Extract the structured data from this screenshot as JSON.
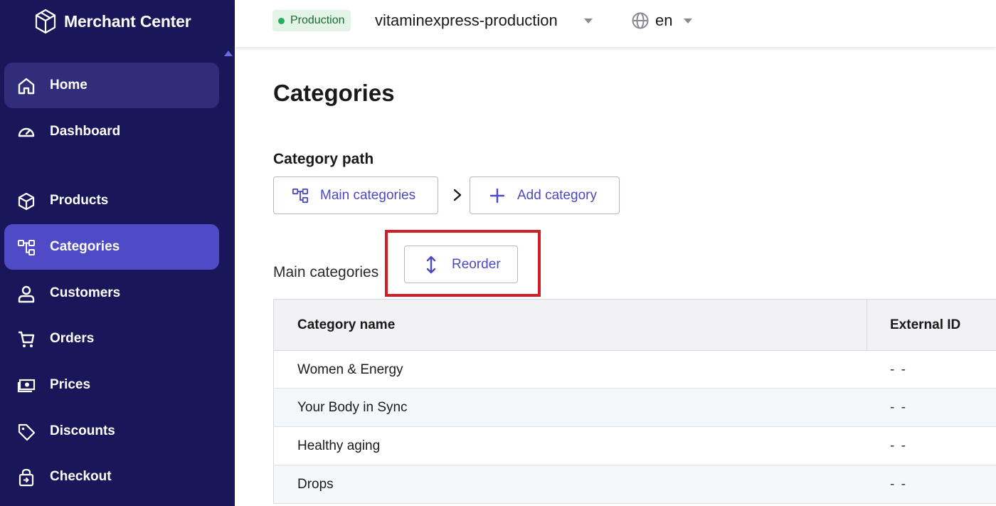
{
  "app": {
    "brand": "Merchant Center"
  },
  "sidebar": {
    "items": [
      {
        "label": "Home",
        "icon": "home-icon"
      },
      {
        "label": "Dashboard",
        "icon": "gauge-icon"
      },
      {
        "label": "Products",
        "icon": "cube-icon"
      },
      {
        "label": "Categories",
        "icon": "tree-icon"
      },
      {
        "label": "Customers",
        "icon": "user-icon"
      },
      {
        "label": "Orders",
        "icon": "cart-icon"
      },
      {
        "label": "Prices",
        "icon": "money-icon"
      },
      {
        "label": "Discounts",
        "icon": "tag-icon"
      },
      {
        "label": "Checkout",
        "icon": "lock-bag-icon"
      }
    ],
    "active_item": "Categories"
  },
  "header": {
    "environment": "Production",
    "project": "vitaminexpress-production",
    "language": "en"
  },
  "page": {
    "title": "Categories",
    "path_label": "Category path",
    "breadcrumb_button": "Main categories",
    "add_button": "Add category",
    "section_label": "Main categories",
    "reorder_button": "Reorder"
  },
  "table": {
    "columns": [
      "Category name",
      "External ID"
    ],
    "rows": [
      {
        "name": "Women & Energy",
        "external_id": "- -"
      },
      {
        "name": "Your Body in Sync",
        "external_id": "- -"
      },
      {
        "name": "Healthy aging",
        "external_id": "- -"
      },
      {
        "name": "Drops",
        "external_id": "- -"
      }
    ]
  },
  "colors": {
    "sidebar_bg": "#19165a",
    "active_nav": "#4f4bc6",
    "accent": "#4c49c0",
    "highlight": "#d21f26",
    "env_green": "#21b05b"
  }
}
